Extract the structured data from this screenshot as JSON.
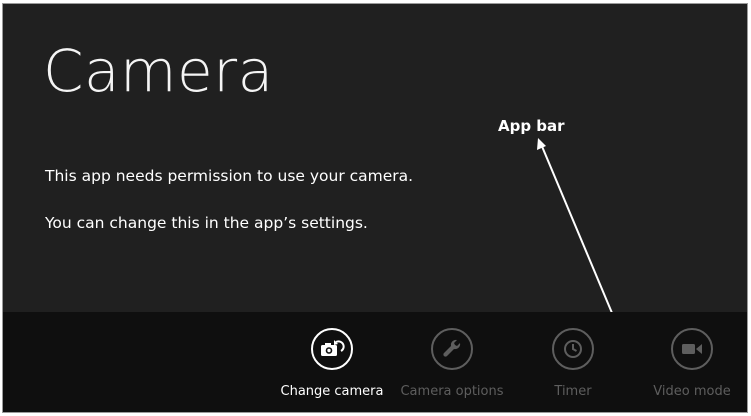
{
  "app": {
    "title": "Camera"
  },
  "messages": {
    "permission": "This app needs permission to use your camera.",
    "settings_hint": "You can change this in the app’s settings."
  },
  "annotation": {
    "label": "App bar"
  },
  "app_bar": {
    "commands": [
      {
        "label": "Change camera",
        "icon": "change-camera-icon",
        "enabled": true
      },
      {
        "label": "Camera options",
        "icon": "wrench-icon",
        "enabled": false
      },
      {
        "label": "Timer",
        "icon": "clock-icon",
        "enabled": false
      },
      {
        "label": "Video mode",
        "icon": "video-camera-icon",
        "enabled": false
      }
    ]
  },
  "colors": {
    "background": "#202020",
    "app_bar": "#0f0f0f",
    "text": "#ffffff",
    "disabled": "#5e5e5e"
  }
}
